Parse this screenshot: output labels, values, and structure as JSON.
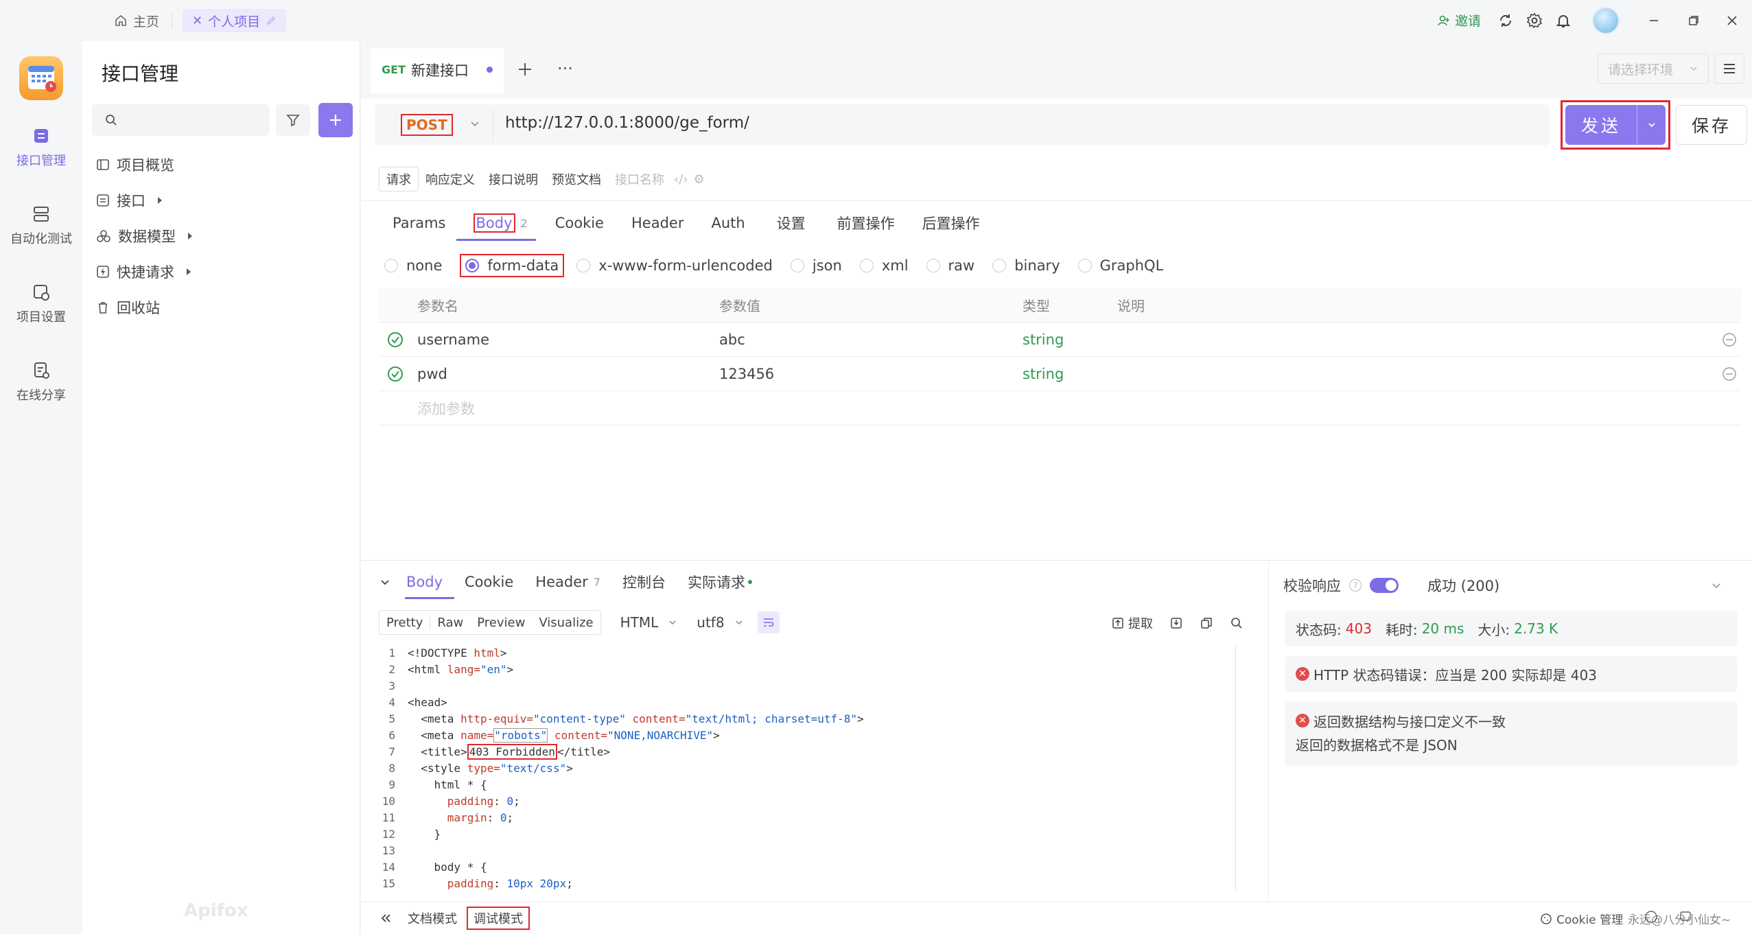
{
  "topbar": {
    "home_tab": "主页",
    "project_tab": "个人项目",
    "invite": "邀请"
  },
  "leftnav": {
    "items": [
      {
        "label": "接口管理"
      },
      {
        "label": "自动化测试"
      },
      {
        "label": "项目设置"
      },
      {
        "label": "在线分享"
      }
    ]
  },
  "sidebar": {
    "title": "接口管理",
    "items": [
      {
        "label": "项目概览"
      },
      {
        "label": "接口"
      },
      {
        "label": "数据模型"
      },
      {
        "label": "快捷请求"
      },
      {
        "label": "回收站"
      }
    ],
    "watermark": "Apifox"
  },
  "tab": {
    "method_tag": "GET",
    "title": "新建接口"
  },
  "env": {
    "placeholder": "请选择环境"
  },
  "request": {
    "method": "POST",
    "url": "http://127.0.0.1:8000/ge_form/",
    "send_label": "发送",
    "save_label": "保存",
    "subtabs": [
      "请求",
      "响应定义",
      "接口说明",
      "预览文档",
      "接口名称"
    ],
    "tabs": [
      "Params",
      "Body",
      "Cookie",
      "Header",
      "Auth",
      "设置",
      "前置操作",
      "后置操作"
    ],
    "body_count": "2",
    "body_types": [
      "none",
      "form-data",
      "x-www-form-urlencoded",
      "json",
      "xml",
      "raw",
      "binary",
      "GraphQL"
    ],
    "table": {
      "headers": [
        "参数名",
        "参数值",
        "类型",
        "说明"
      ],
      "rows": [
        {
          "name": "username",
          "value": "abc",
          "type": "string"
        },
        {
          "name": "pwd",
          "value": "123456",
          "type": "string"
        }
      ],
      "add_placeholder": "添加参数"
    }
  },
  "response": {
    "tabs": [
      "Body",
      "Cookie",
      "Header",
      "控制台",
      "实际请求"
    ],
    "header_count": "7",
    "views": [
      "Pretty",
      "Raw",
      "Preview",
      "Visualize"
    ],
    "format": "HTML",
    "encoding": "utf8",
    "extract": "提取",
    "code_line_numbers": [
      "1",
      "2",
      "3",
      "4",
      "5",
      "6",
      "7",
      "8",
      "9",
      "10",
      "11",
      "12",
      "13",
      "14",
      "15"
    ],
    "code": {
      "l1a": "<!DOCTYPE ",
      "l1b": "html",
      "l1c": ">",
      "l2a": "<html ",
      "l2b": "lang=",
      "l2c": "\"en\"",
      "l2d": ">",
      "l4": "<head>",
      "l5a": "  <meta ",
      "l5b": "http-equiv=",
      "l5c": "\"content-type\"",
      "l5d": " content=",
      "l5e": "\"text/html; charset=utf-8\"",
      "l5f": ">",
      "l6a": "  <meta ",
      "l6b": "name=",
      "l6c": "\"robots\"",
      "l6d": " content=",
      "l6e": "\"NONE,NOARCHIVE\"",
      "l6f": ">",
      "l7a": "  <title>",
      "l7b": "403 Forbidden",
      "l7c": "</title>",
      "l8a": "  <style ",
      "l8b": "type=",
      "l8c": "\"text/css\"",
      "l8d": ">",
      "l9": "    html * {",
      "l10a": "      ",
      "l10b": "padding",
      "l10c": ": ",
      "l10d": "0",
      "l10e": ";",
      "l11a": "      ",
      "l11b": "margin",
      "l11c": ": ",
      "l11d": "0",
      "l11e": ";",
      "l12": "    }",
      "l14": "    body * {",
      "l15a": "      ",
      "l15b": "padding",
      "l15c": ": ",
      "l15d": "10px 20px",
      "l15e": ";"
    }
  },
  "validation": {
    "label": "校验响应",
    "result": "成功 (200)",
    "status_label": "状态码:",
    "status_value": "403",
    "time_label": "耗时:",
    "time_value": "20 ms",
    "size_label": "大小:",
    "size_value": "2.73 K",
    "error1": "HTTP 状态码错误：应当是 200 实际却是 403",
    "error2_title": "返回数据结构与接口定义不一致",
    "error2_detail": "返回的数据格式不是 JSON"
  },
  "bottom": {
    "doc_mode": "文档模式",
    "debug_mode": "调试模式",
    "cookie": "Cookie 管理",
    "credit": "永远@八分小仙女~"
  },
  "colors": {
    "accent": "#8a78ef",
    "highlight": "#e0282e",
    "success": "#2f9b4f",
    "method": "#e36b1c"
  }
}
